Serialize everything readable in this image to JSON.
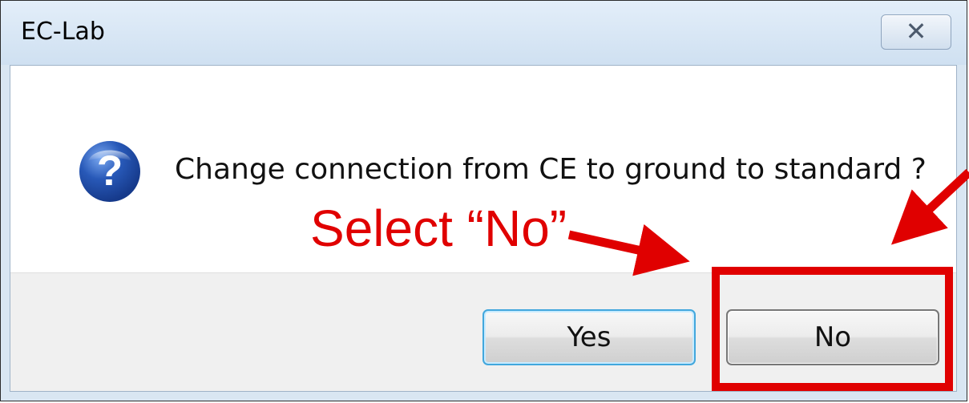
{
  "window": {
    "title": "EC-Lab",
    "close_glyph": "✕"
  },
  "dialog": {
    "icon": "question-icon",
    "message": "Change connection from CE to ground to standard ?"
  },
  "buttons": {
    "yes_label": "Yes",
    "no_label": "No"
  },
  "annotation": {
    "text": "Select “No”",
    "color": "#e00000"
  }
}
